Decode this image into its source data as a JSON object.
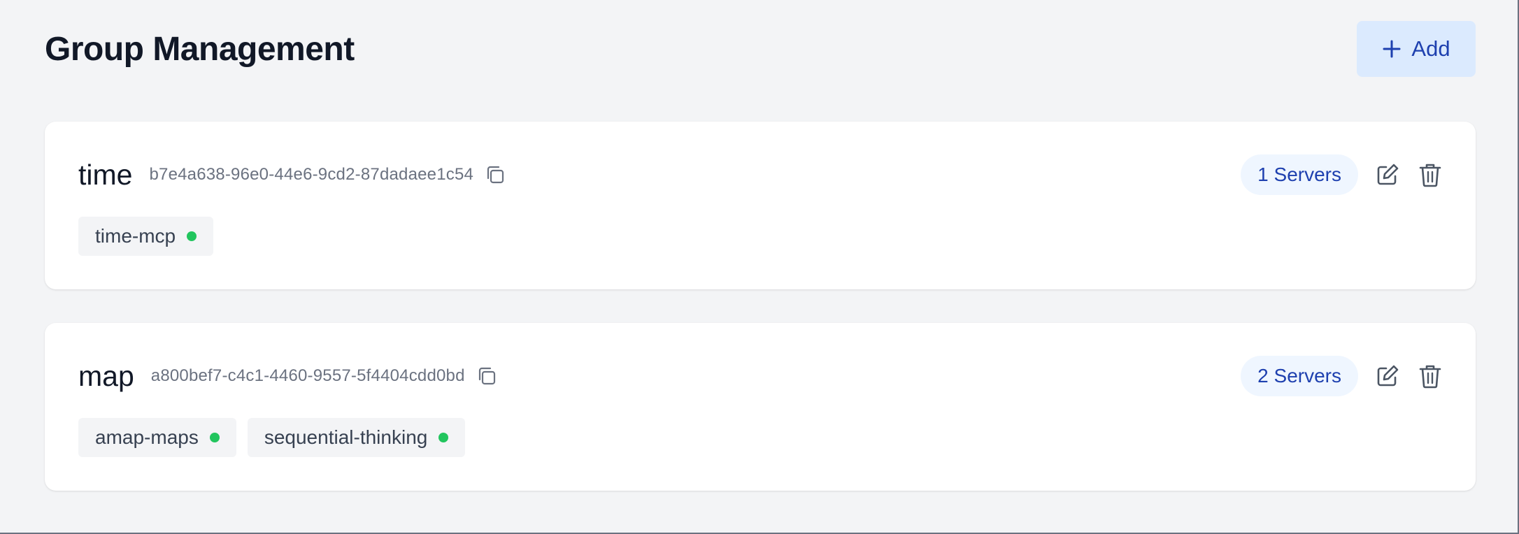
{
  "header": {
    "title": "Group Management",
    "add_label": "Add",
    "add_icon": "plus-icon"
  },
  "groups": [
    {
      "name": "time",
      "id": "b7e4a638-96e0-44e6-9cd2-87dadaee1c54",
      "server_count_label": "1 Servers",
      "servers": [
        {
          "name": "time-mcp",
          "status_color": "#22c55e"
        }
      ]
    },
    {
      "name": "map",
      "id": "a800bef7-c4c1-4460-9557-5f4404cdd0bd",
      "server_count_label": "2 Servers",
      "servers": [
        {
          "name": "amap-maps",
          "status_color": "#22c55e"
        },
        {
          "name": "sequential-thinking",
          "status_color": "#22c55e"
        }
      ]
    }
  ],
  "colors": {
    "accent": "#1e40af",
    "accent_bg": "#dbeafe",
    "badge_bg": "#eff6ff",
    "status_online": "#22c55e"
  }
}
